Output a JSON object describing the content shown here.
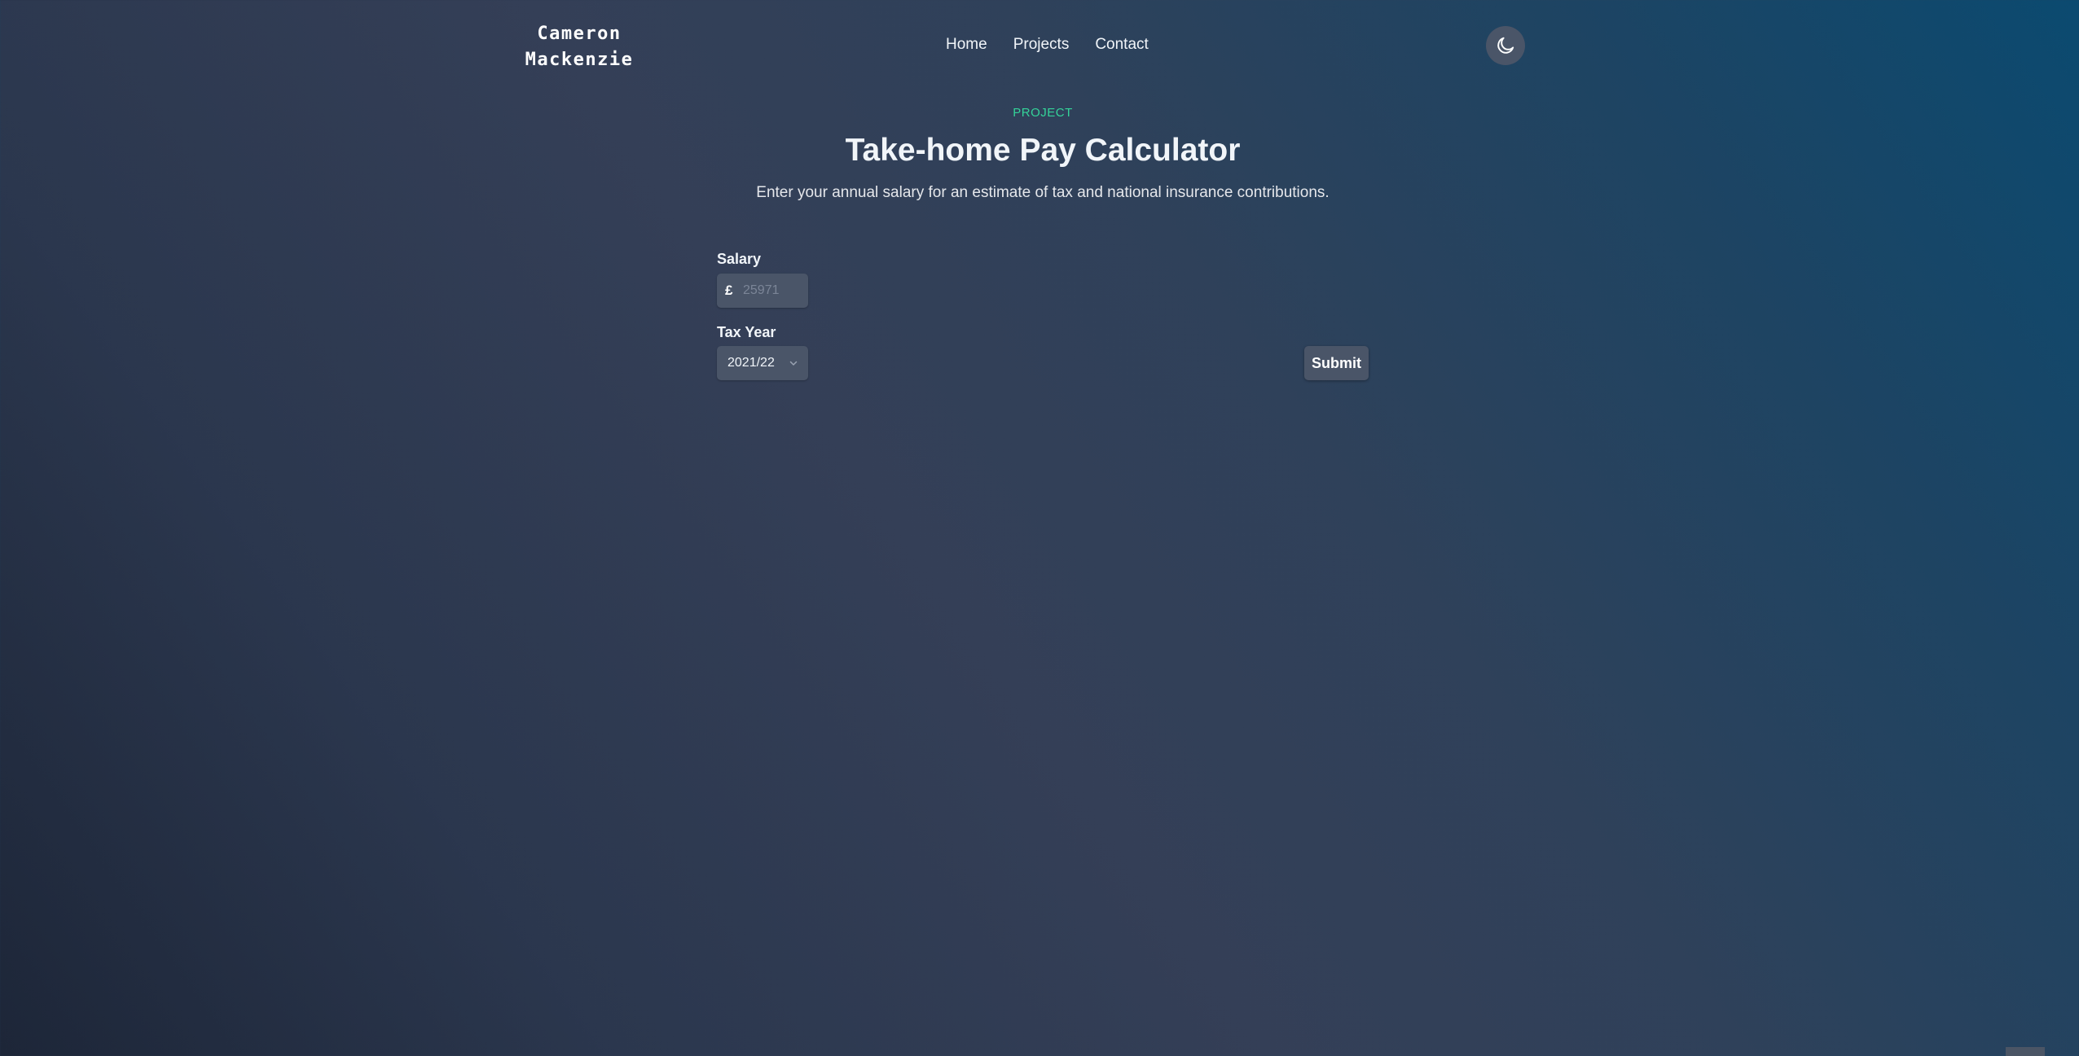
{
  "header": {
    "logo_line1": "Cameron",
    "logo_line2": "Mackenzie",
    "nav": [
      {
        "label": "Home"
      },
      {
        "label": "Projects"
      },
      {
        "label": "Contact"
      }
    ],
    "theme_toggle_icon": "moon-icon"
  },
  "hero": {
    "eyebrow": "PROJECT",
    "title": "Take-home Pay Calculator",
    "subtitle": "Enter your annual salary for an estimate of tax and national insurance contributions."
  },
  "form": {
    "salary_label": "Salary",
    "currency_symbol": "£",
    "salary_value": "",
    "salary_placeholder": "25971",
    "tax_year_label": "Tax Year",
    "tax_year_selected": "2021/22",
    "submit_label": "Submit"
  },
  "colors": {
    "accent": "#34d399",
    "control_bg": "#4a5568"
  }
}
